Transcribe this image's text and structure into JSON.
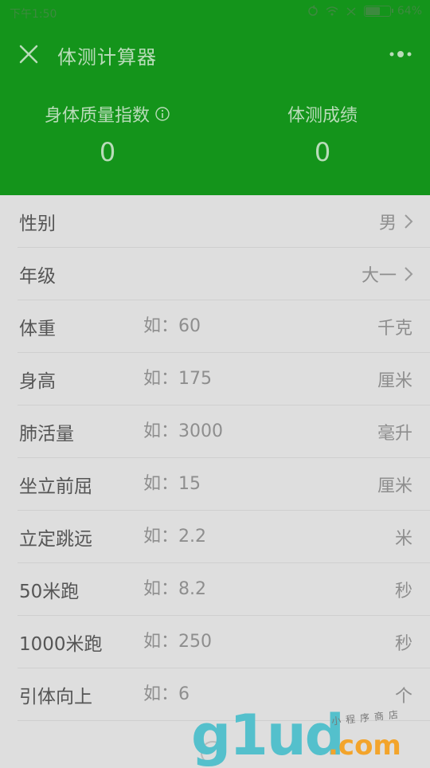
{
  "status_bar": {
    "time": "下午1:50",
    "battery": "64%",
    "battery_level": 0.64
  },
  "nav": {
    "title": "体测计算器",
    "close_icon": "close-icon",
    "more_icon": "more-icon"
  },
  "stats": {
    "bmi_label": "身体质量指数",
    "bmi_value": "0",
    "score_label": "体测成绩",
    "score_value": "0"
  },
  "form": {
    "gender": {
      "label": "性别",
      "value": "男"
    },
    "grade": {
      "label": "年级",
      "value": "大一"
    },
    "weight": {
      "label": "体重",
      "placeholder": "如：60",
      "unit": "千克"
    },
    "height": {
      "label": "身高",
      "placeholder": "如：175",
      "unit": "厘米"
    },
    "lung": {
      "label": "肺活量",
      "placeholder": "如：3000",
      "unit": "毫升"
    },
    "sit_reach": {
      "label": "坐立前屈",
      "placeholder": "如：15",
      "unit": "厘米"
    },
    "long_jump": {
      "label": "立定跳远",
      "placeholder": "如：2.2",
      "unit": "米"
    },
    "run_50": {
      "label": "50米跑",
      "placeholder": "如：8.2",
      "unit": "秒"
    },
    "run_1000": {
      "label": "1000米跑",
      "placeholder": "如：250",
      "unit": "秒"
    },
    "pullup": {
      "label": "引体向上",
      "placeholder": "如：6",
      "unit": "个"
    }
  },
  "watermark": {
    "logo": "g1ud",
    "domain": ".com",
    "sub": "小程序商店"
  },
  "colors": {
    "header_green": "#14941b",
    "overlay_bg": "#dedede",
    "watermark_teal": "#54c0cc",
    "watermark_orange": "#f3a42b"
  }
}
